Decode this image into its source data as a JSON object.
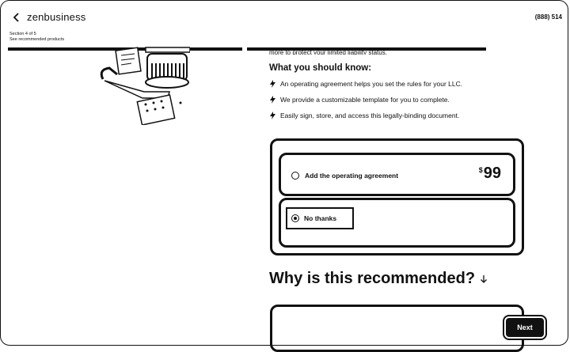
{
  "header": {
    "brand": "zenbusiness",
    "phone": "(888) 514",
    "section_label": "Section 4 of 5",
    "section_sub": "See recommended products"
  },
  "content": {
    "cut_text": "more to protect your limited liability status.",
    "know_heading": "What you should know:",
    "bullets": [
      "An operating agreement helps you set the rules for your LLC.",
      "We provide a customizable template for you to complete.",
      "Easily sign, store, and access this legally-binding document."
    ]
  },
  "options": {
    "add": {
      "label": "Add the operating agreement",
      "currency": "$",
      "amount": "99",
      "selected": false
    },
    "decline": {
      "label": "No thanks",
      "selected": true
    }
  },
  "why_heading": "Why is this recommended?",
  "next_label": "Next",
  "icons": {
    "back": "chevron-left-icon",
    "bullet": "lightning-bolt-icon",
    "why_arrow": "arrow-down-icon"
  }
}
